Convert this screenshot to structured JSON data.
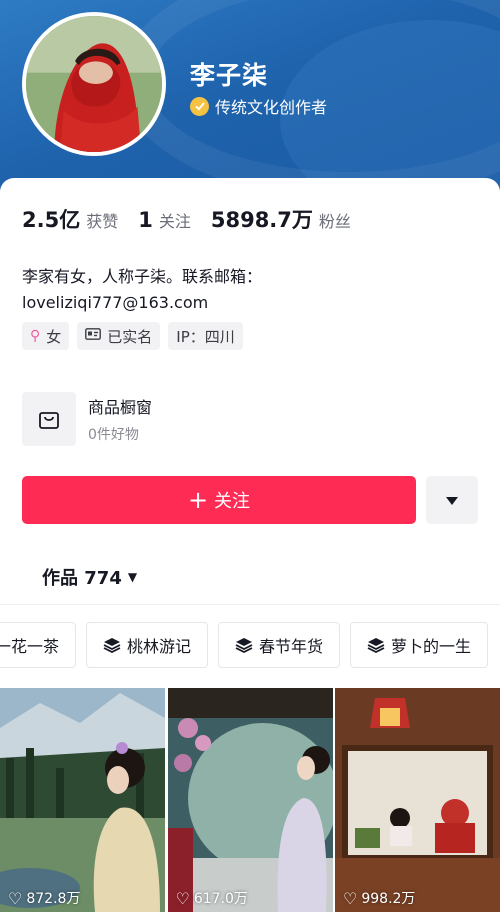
{
  "profile": {
    "username": "李子柒",
    "verify_label": "传统文化创作者",
    "colors": {
      "brand_red": "#fe2c55",
      "header_blue": "#1f63ad",
      "verify_gold": "#f5c242"
    }
  },
  "stats": [
    {
      "value": "2.5亿",
      "label": "获赞"
    },
    {
      "value": "1",
      "label": "关注"
    },
    {
      "value": "5898.7万",
      "label": "粉丝"
    }
  ],
  "bio": {
    "line1": "李家有女，人称子柒。联系邮箱：",
    "line2": "loveliziqi777@163.com"
  },
  "tags": [
    {
      "icon": "female-icon",
      "label": "女"
    },
    {
      "icon": "id-card-icon",
      "label": "已实名"
    },
    {
      "icon": "",
      "label": "IP：四川"
    }
  ],
  "shop": {
    "title": "商品橱窗",
    "subtitle": "0件好物",
    "icon": "shopping-bag-icon"
  },
  "actions": {
    "follow_label": "关注",
    "more_icon": "caret-down-icon"
  },
  "works_tab": {
    "label": "作品 774"
  },
  "collections": [
    {
      "label": "一花一茶"
    },
    {
      "label": "桃林游记"
    },
    {
      "label": "春节年货"
    },
    {
      "label": "萝卜的一生"
    }
  ],
  "videos": [
    {
      "likes": "872.8万"
    },
    {
      "likes": "617.0万"
    },
    {
      "likes": "998.2万"
    }
  ]
}
